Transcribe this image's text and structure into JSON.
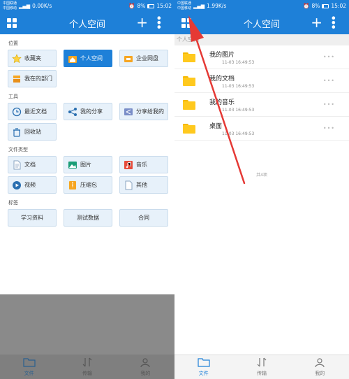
{
  "left": {
    "status": {
      "carrier1": "中国联通",
      "carrier2": "中国移动",
      "speed": "0.00K/s",
      "battery": "8%",
      "time": "15:02"
    },
    "title": "个人空间",
    "sections": [
      {
        "label": "位置",
        "rows": [
          [
            {
              "label": "收藏夹",
              "icon": "star-icon"
            },
            {
              "label": "个人空间",
              "icon": "home-icon",
              "active": true
            },
            {
              "label": "企业网盘",
              "icon": "cloud-drive-icon"
            }
          ],
          [
            {
              "label": "我在的部门",
              "icon": "department-icon"
            }
          ]
        ]
      },
      {
        "label": "工具",
        "rows": [
          [
            {
              "label": "最近文档",
              "icon": "clock-icon"
            },
            {
              "label": "我的分享",
              "icon": "share-icon"
            },
            {
              "label": "分享给我的",
              "icon": "shared-to-me-icon"
            }
          ],
          [
            {
              "label": "回收站",
              "icon": "trash-icon"
            }
          ]
        ]
      },
      {
        "label": "文件类型",
        "rows": [
          [
            {
              "label": "文档",
              "icon": "document-icon"
            },
            {
              "label": "图片",
              "icon": "image-icon"
            },
            {
              "label": "音乐",
              "icon": "music-icon"
            }
          ],
          [
            {
              "label": "视频",
              "icon": "video-icon"
            },
            {
              "label": "压缩包",
              "icon": "archive-icon"
            },
            {
              "label": "其他",
              "icon": "other-file-icon"
            }
          ]
        ]
      },
      {
        "label": "标签",
        "rows": [
          [
            {
              "label": "学习资料"
            },
            {
              "label": "测试数据"
            },
            {
              "label": "合同"
            }
          ]
        ]
      }
    ],
    "nav": [
      {
        "label": "文件",
        "icon": "folder-icon",
        "active": true
      },
      {
        "label": "传输",
        "icon": "transfer-icon"
      },
      {
        "label": "我的",
        "icon": "user-icon"
      }
    ]
  },
  "right": {
    "status": {
      "carrier1": "中国联通",
      "carrier2": "中国移动",
      "speed": "1.99K/s",
      "battery": "8%",
      "time": "15:02"
    },
    "title": "个人空间",
    "breadcrumb": "个人空间",
    "files": [
      {
        "name": "我的图片",
        "date": "11-03 16:49:53"
      },
      {
        "name": "我的文档",
        "date": "11-03 16:49:53"
      },
      {
        "name": "我的音乐",
        "date": "11-03 16:49:53"
      },
      {
        "name": "桌面",
        "date": "11-03 16:49:53"
      }
    ],
    "count": "共4项",
    "nav": [
      {
        "label": "文件",
        "icon": "folder-icon",
        "active": true
      },
      {
        "label": "传输",
        "icon": "transfer-icon"
      },
      {
        "label": "我的",
        "icon": "user-icon"
      }
    ]
  },
  "colors": {
    "primary": "#1e80d8",
    "tile_bg": "#e7f1fa",
    "folder": "#ffc91e",
    "arrow": "#e53935"
  }
}
